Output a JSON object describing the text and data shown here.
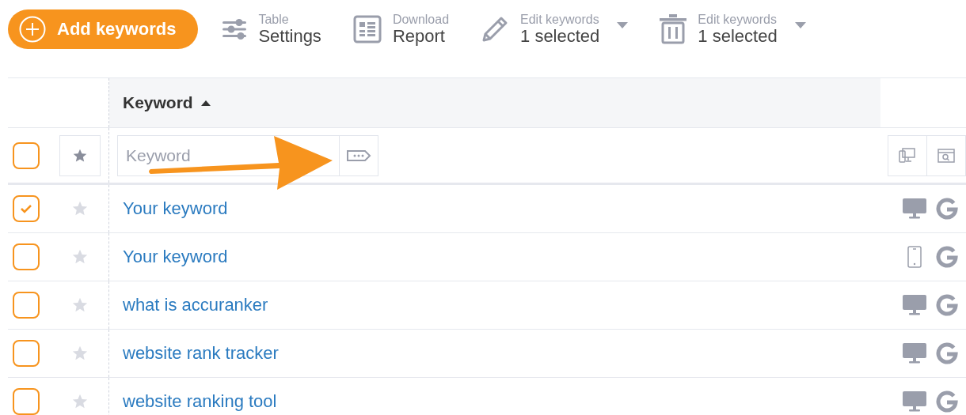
{
  "toolbar": {
    "add_button": {
      "label": "Add keywords"
    },
    "tools": [
      {
        "kind": "settings",
        "caption": "Table",
        "label": "Settings",
        "dropdown": false
      },
      {
        "kind": "report",
        "caption": "Download",
        "label": "Report",
        "dropdown": false
      },
      {
        "kind": "edit",
        "caption": "Edit keywords",
        "label": "1 selected",
        "dropdown": true
      },
      {
        "kind": "delete",
        "caption": "Edit keywords",
        "label": "1 selected",
        "dropdown": true
      }
    ]
  },
  "table": {
    "columns": [
      {
        "label": "Keyword",
        "sort_ascending": true
      }
    ],
    "filter_row": {
      "checked": false,
      "placeholder": "Keyword"
    },
    "rows": [
      {
        "keyword": "Your keyword",
        "checked": true,
        "starred": false,
        "mobile": false
      },
      {
        "keyword": "Your keyword",
        "checked": false,
        "starred": false,
        "mobile": true
      },
      {
        "keyword": "what is accuranker",
        "checked": false,
        "starred": false,
        "mobile": false
      },
      {
        "keyword": "website rank tracker",
        "checked": false,
        "starred": false,
        "mobile": false
      },
      {
        "keyword": "website ranking tool",
        "checked": false,
        "starred": false,
        "mobile": false
      }
    ]
  }
}
